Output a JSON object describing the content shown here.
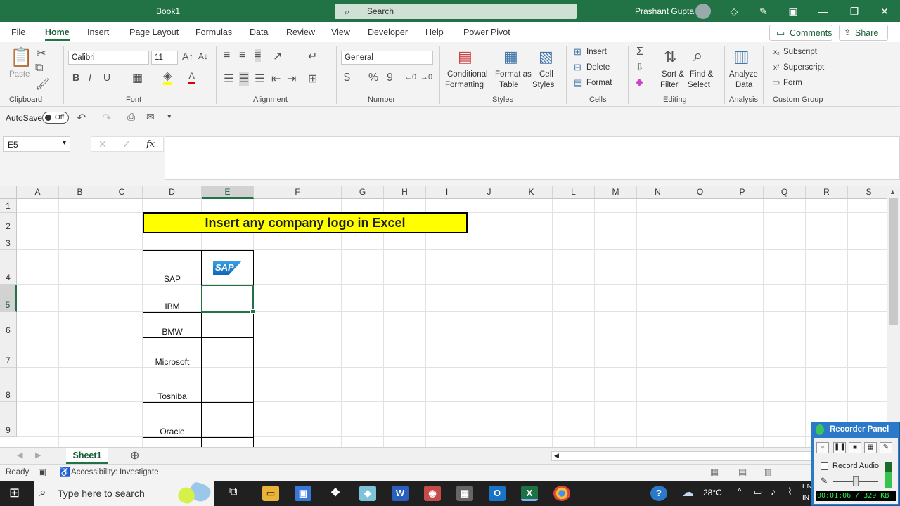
{
  "app": {
    "doc_title": "Book1",
    "search_label": "Search",
    "user": "Prashant Gupta"
  },
  "menu": {
    "items": [
      "File",
      "Home",
      "Insert",
      "Page Layout",
      "Formulas",
      "Data",
      "Review",
      "View",
      "Developer",
      "Help",
      "Power Pivot"
    ],
    "comments_label": "Comments",
    "share_label": "Share"
  },
  "ribbon": {
    "clipboard": {
      "paste": "Paste",
      "group": "Clipboard"
    },
    "font": {
      "name": "Calibri",
      "size": "11",
      "group": "Font"
    },
    "alignment": {
      "group": "Alignment"
    },
    "number": {
      "format": "General",
      "group": "Number"
    },
    "styles": {
      "conditional_1": "Conditional",
      "conditional_2": "Formatting",
      "format_as_1": "Format as",
      "format_as_2": "Table",
      "cell_1": "Cell",
      "cell_2": "Styles",
      "group": "Styles"
    },
    "cells": {
      "insert": "Insert",
      "delete": "Delete",
      "format": "Format",
      "group": "Cells"
    },
    "editing": {
      "sort_1": "Sort &",
      "sort_2": "Filter",
      "find_1": "Find &",
      "find_2": "Select",
      "group": "Editing"
    },
    "analysis": {
      "analyze_1": "Analyze",
      "analyze_2": "Data",
      "group": "Analysis"
    },
    "custom": {
      "subscript": "Subscript",
      "superscript": "Superscript",
      "form": "Form",
      "group": "Custom Group"
    }
  },
  "qat": {
    "autosave": "AutoSave",
    "autosave_state": "Off"
  },
  "formula_bar": {
    "name_box": "E5",
    "fx": "fx",
    "formula": ""
  },
  "grid": {
    "columns": [
      "A",
      "B",
      "C",
      "D",
      "E",
      "F",
      "G",
      "H",
      "I",
      "J",
      "K",
      "L",
      "M",
      "N",
      "O",
      "P",
      "Q",
      "R",
      "S"
    ],
    "rows": [
      "1",
      "2",
      "3",
      "4",
      "5",
      "6",
      "7",
      "8",
      "9"
    ],
    "title": "Insert any company logo in Excel",
    "companies": [
      "SAP",
      "IBM",
      "BMW",
      "Microsoft",
      "Toshiba",
      "Oracle"
    ],
    "logo_text": "SAP",
    "selected_cell": "E5"
  },
  "sheets": {
    "active": "Sheet1"
  },
  "status": {
    "ready": "Ready",
    "accessibility": "Accessibility: Investigate"
  },
  "taskbar": {
    "search_placeholder": "Type here to search",
    "temperature": "28°C",
    "lang_1": "EN",
    "lang_2": "IN"
  },
  "recorder": {
    "title": "Recorder Panel",
    "record_audio": "Record Audio",
    "time": "00:01:06 / 329 KB"
  },
  "colors": {
    "excel_green": "#217346",
    "title_fill": "#ffff00",
    "recorder_blue": "#2b79c9"
  }
}
